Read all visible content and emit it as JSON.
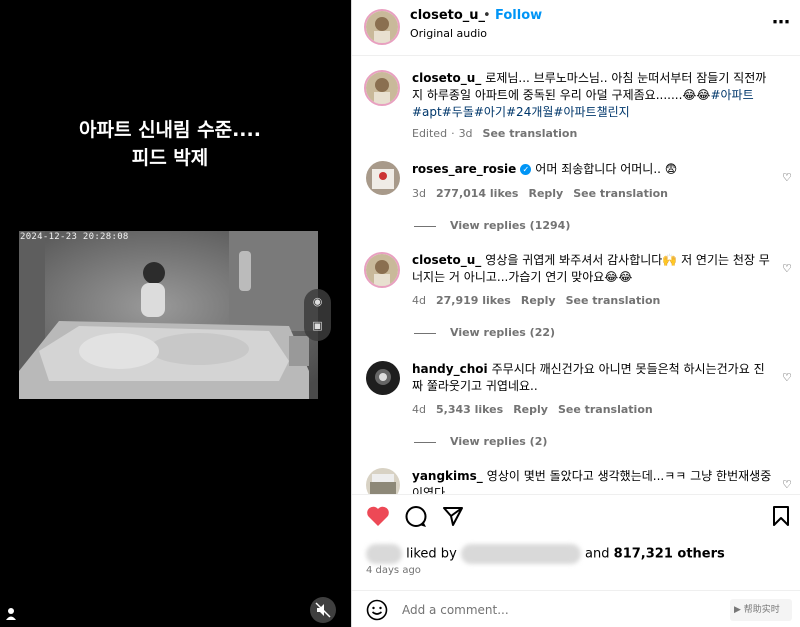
{
  "video": {
    "caption_line1": "아파트 신내림 수준....",
    "caption_line2": "피드 박제",
    "timestamp": "2024-12-23 20:28:08"
  },
  "header": {
    "username": "closeto_u_",
    "separator": "•",
    "follow_label": "Follow",
    "audio_label": "Original audio",
    "more_icon": "more-dots-icon"
  },
  "caption": {
    "username": "closeto_u_",
    "text": "로제님... 브루노마스님.. 아침 눈떠서부터 잠들기 직전까지 하루종일 아파트에 중독된 우리 아덜 구제좀요.......😂😂",
    "tags": "#아파트#apt#두돌#아기#24개월#아파트챌린지",
    "edited": "Edited",
    "age": "3d",
    "see_translation": "See translation"
  },
  "comments": [
    {
      "username": "roses_are_rosie",
      "text": "어머 죄송합니다 어머니.. 😨",
      "age": "3d",
      "likes": "277,014 likes",
      "reply": "Reply",
      "see_translation": "See translation",
      "view_replies": "View replies (1294)"
    },
    {
      "username": "closeto_u_",
      "text": "영상을 귀엽게 봐주셔서 감사합니다🙌 저 연기는 천장 무너지는 거 아니고...가습기 연기 맞아요😂😂",
      "age": "4d",
      "likes": "27,919 likes",
      "reply": "Reply",
      "see_translation": "See translation",
      "view_replies": "View replies (22)"
    },
    {
      "username": "handy_choi",
      "text": "주무시다 깨신건가요 아니면 못들은척 하시는건가요 진짜 쭐라웃기고 귀엽네요..",
      "age": "4d",
      "likes": "5,343 likes",
      "reply": "Reply",
      "see_translation": "See translation",
      "view_replies": "View replies (2)"
    },
    {
      "username": "yangkims_",
      "text": "영상이 몇번 돌았다고 생각했는데...ㅋㅋ 그냥 한번재생중이였다.."
    }
  ],
  "footer": {
    "liked_prefix": "liked by",
    "liked_suffix": "and",
    "others": "817,321 others",
    "time_ago": "4 days ago",
    "add_comment_placeholder": "Add a comment...",
    "watermark": "▶ 帮助实时"
  },
  "colors": {
    "accent": "#0095f6",
    "like_red": "#ed4956",
    "muted": "#737373"
  }
}
